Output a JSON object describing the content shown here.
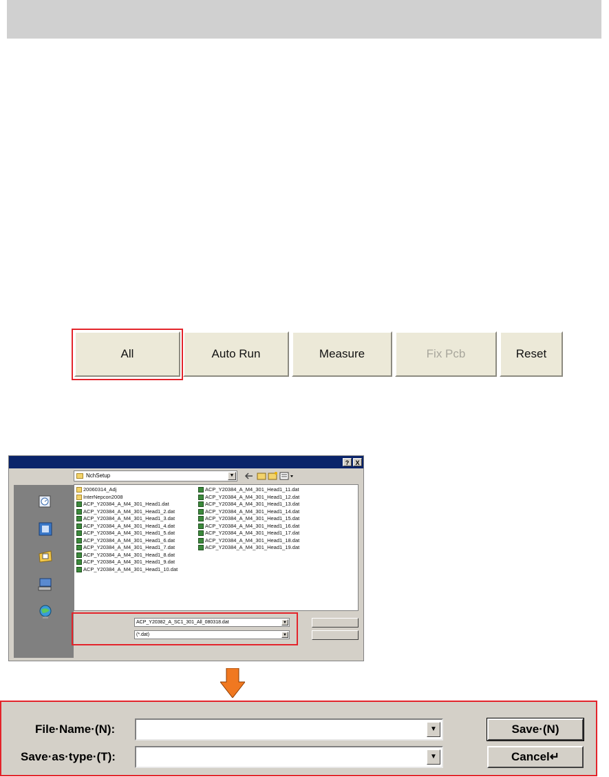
{
  "toolbar": {
    "buttons": [
      {
        "label": "All",
        "enabled": true,
        "highlighted": true
      },
      {
        "label": "Auto Run",
        "enabled": true
      },
      {
        "label": "Measure",
        "enabled": true
      },
      {
        "label": "Fix Pcb",
        "enabled": false
      },
      {
        "label": "Reset",
        "enabled": true
      }
    ]
  },
  "dialog": {
    "title_buttons": [
      "?",
      "X"
    ],
    "look_in": "NchSetup",
    "files_col1": [
      "20060314_Adj",
      "InterNepcon2008",
      "ACP_Y20384_A_M4_301_Head1.dat",
      "ACP_Y20384_A_M4_301_Head1_2.dat",
      "ACP_Y20384_A_M4_301_Head1_3.dat",
      "ACP_Y20384_A_M4_301_Head1_4.dat",
      "ACP_Y20384_A_M4_301_Head1_5.dat",
      "ACP_Y20384_A_M4_301_Head1_6.dat",
      "ACP_Y20384_A_M4_301_Head1_7.dat",
      "ACP_Y20384_A_M4_301_Head1_8.dat",
      "ACP_Y20384_A_M4_301_Head1_9.dat",
      "ACP_Y20384_A_M4_301_Head1_10.dat"
    ],
    "files_col2": [
      "ACP_Y20384_A_M4_301_Head1_11.dat",
      "ACP_Y20384_A_M4_301_Head1_12.dat",
      "ACP_Y20384_A_M4_301_Head1_13.dat",
      "ACP_Y20384_A_M4_301_Head1_14.dat",
      "ACP_Y20384_A_M4_301_Head1_15.dat",
      "ACP_Y20384_A_M4_301_Head1_16.dat",
      "ACP_Y20384_A_M4_301_Head1_17.dat",
      "ACP_Y20384_A_M4_301_Head1_18.dat",
      "ACP_Y20384_A_M4_301_Head1_19.dat"
    ],
    "file_name_value": "ACP_Y20382_A_SC1_301_All_080318.dat",
    "save_type_value": "(*.dat)"
  },
  "zoom": {
    "file_name_label": "File·Name·(N):",
    "save_type_label": "Save·as·type·(T):",
    "save_label": "Save·(N)",
    "cancel_label": "Cancel↵"
  },
  "colors": {
    "highlight": "#e3232a",
    "arrow": "#f07820",
    "titlebar": "#0a246a"
  }
}
